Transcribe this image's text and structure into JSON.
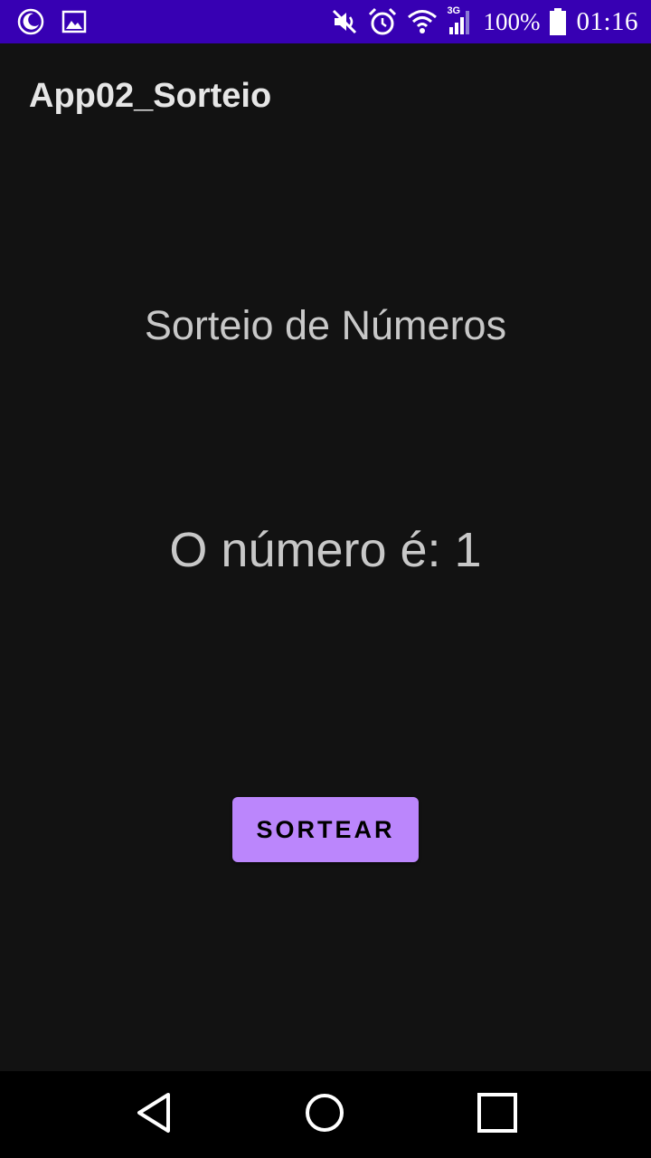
{
  "status_bar": {
    "battery": "100%",
    "time": "01:16",
    "network_type": "3G",
    "left_icons": [
      "moon-icon",
      "image-icon"
    ],
    "right_icons": [
      "mute-icon",
      "alarm-icon",
      "wifi-icon",
      "signal-icon",
      "battery-icon"
    ],
    "background_color": "#3700b3"
  },
  "app_bar": {
    "title": "App02_Sorteio"
  },
  "main": {
    "heading": "Sorteio de Números",
    "result": "O número é: 1",
    "draw_button_label": "SORTEAR",
    "accent_color": "#bb86fc"
  },
  "nav_bar": {
    "buttons": [
      "back-icon",
      "home-icon",
      "recents-icon"
    ]
  }
}
